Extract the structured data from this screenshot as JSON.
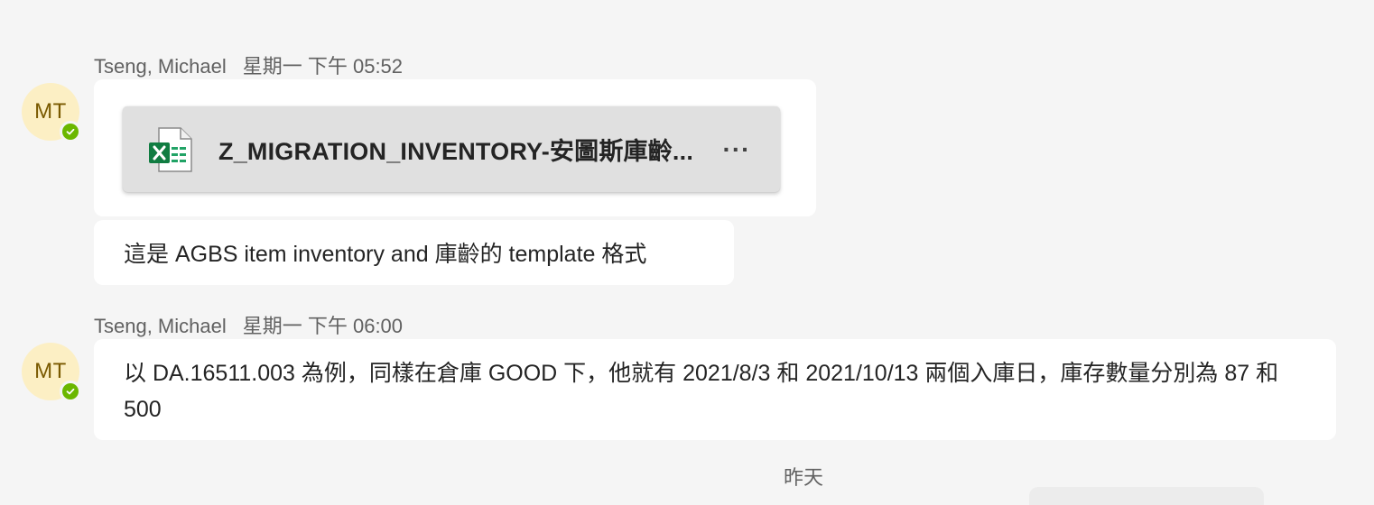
{
  "messages": [
    {
      "sender": "Tseng, Michael",
      "timestamp": "星期一 下午 05:52",
      "avatar_initials": "MT",
      "presence_status": "available",
      "attachment": {
        "file_name": "Z_MIGRATION_INVENTORY-安圖斯庫齡...",
        "icon": "excel-file-icon",
        "more_label": "···"
      },
      "text": "這是 AGBS item inventory and 庫齡的 template 格式"
    },
    {
      "sender": "Tseng, Michael",
      "timestamp": "星期一 下午 06:00",
      "avatar_initials": "MT",
      "presence_status": "available",
      "text": "以 DA.16511.003 為例，同樣在倉庫 GOOD 下，他就有 2021/8/3 和 2021/10/13 兩個入庫日，庫存數量分別為 87 和 500"
    }
  ],
  "date_divider": "昨天",
  "colors": {
    "background": "#f5f5f5",
    "bubble": "#ffffff",
    "file_card": "#e0e0e0",
    "avatar_bg": "#fcefc4",
    "avatar_text": "#7a5a00",
    "presence_available": "#6bb700",
    "excel_green": "#107c41"
  }
}
